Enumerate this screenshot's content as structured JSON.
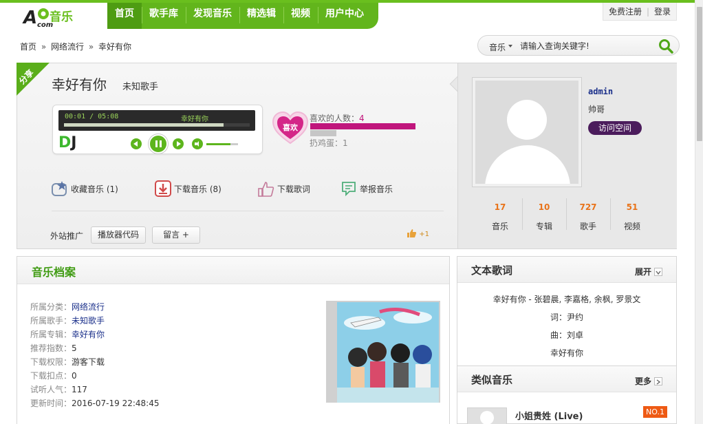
{
  "site": {
    "logo_text": "A音乐com"
  },
  "nav": {
    "items": [
      {
        "label": "首页"
      },
      {
        "label": "歌手库"
      },
      {
        "label": "发现音乐"
      },
      {
        "label": "精选辑"
      },
      {
        "label": "视频"
      },
      {
        "label": "用户中心"
      }
    ]
  },
  "login": {
    "register": "免费注册",
    "login": "登录"
  },
  "breadcrumb": {
    "home": "首页",
    "category": "网络流行",
    "current": "幸好有你"
  },
  "search": {
    "category": "音乐",
    "placeholder": "请输入查询关键字!"
  },
  "song": {
    "share_tag": "分享",
    "title": "幸好有你",
    "artist": "未知歌手"
  },
  "player": {
    "time": "00:01 / 05:08",
    "now_playing": "幸好有你",
    "progress": 0.86,
    "volume": 0.75,
    "dj_d": "D",
    "dj_j": "J"
  },
  "like": {
    "button": "喜欢",
    "count_label": "喜欢的人数：",
    "count": "4",
    "egg_label": "扔鸡蛋：1"
  },
  "actions": {
    "collect": "收藏音乐 (1)",
    "download": "下载音乐 (8)",
    "lyrics_download": "下载歌词",
    "report": "举报音乐"
  },
  "promo": {
    "label": "外站推广",
    "player_code": "播放器代码",
    "comment": "留言 +",
    "plus_one": "+1"
  },
  "user": {
    "name": "admin",
    "nickname": "帅哥",
    "visit": "访问空间",
    "stats": [
      {
        "num": "17",
        "label": "音乐"
      },
      {
        "num": "10",
        "label": "专辑"
      },
      {
        "num": "727",
        "label": "歌手"
      },
      {
        "num": "51",
        "label": "视频"
      }
    ]
  },
  "profile": {
    "title": "音乐档案",
    "rows": [
      {
        "k": "所属分类：",
        "v": "网络流行"
      },
      {
        "k": "所属歌手：",
        "v": "未知歌手"
      },
      {
        "k": "所属专辑：",
        "v": "幸好有你"
      },
      {
        "k": "推荐指数：",
        "v": "5"
      },
      {
        "k": "下载权限：",
        "v": "游客下载"
      },
      {
        "k": "下载扣点：",
        "v": "0"
      },
      {
        "k": "试听人气：",
        "v": "117"
      },
      {
        "k": "更新时间：",
        "v": "2016-07-19 22:48:45"
      }
    ]
  },
  "lyrics": {
    "title": "文本歌词",
    "expand": "展开",
    "lines": [
      "幸好有你 - 张碧晨, 李嘉格, 余枫, 罗景文",
      "词：尹约",
      "曲：刘卓",
      "幸好有你"
    ]
  },
  "similar": {
    "title": "类似音乐",
    "more": "更多",
    "items": [
      {
        "name": "小姐贵姓 (Live)",
        "rank": "NO.1"
      }
    ]
  },
  "colors": {
    "brand_green": "#62b51c",
    "like_pink": "#c0167c",
    "stat_orange": "#e8731a"
  }
}
